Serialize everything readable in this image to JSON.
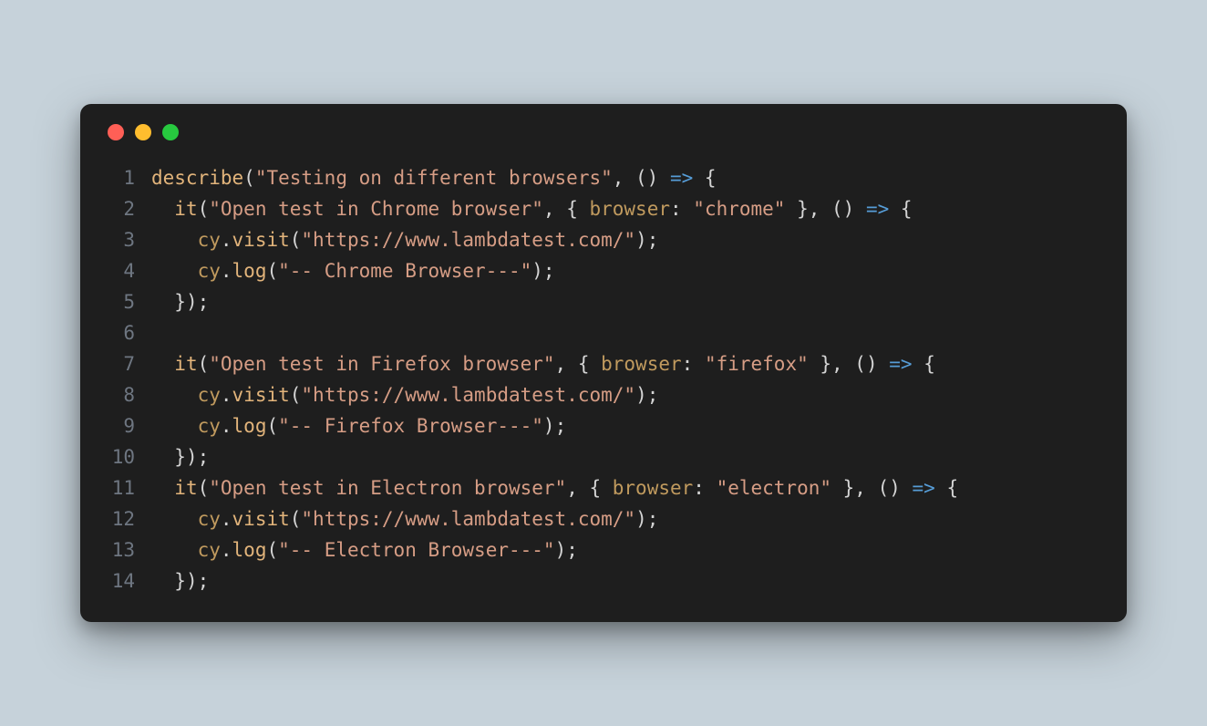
{
  "colors": {
    "background": "#c6d2da",
    "editor_bg": "#1e1e1e",
    "red": "#ff5f56",
    "yellow": "#ffbd2e",
    "green": "#27c93f",
    "lineno": "#6e7681",
    "default": "#d4d4d4",
    "func": "#e2b47b",
    "string": "#d69d85",
    "arrow": "#569cd6"
  },
  "traffic_lights": [
    "close",
    "minimize",
    "zoom"
  ],
  "code": {
    "lines": [
      {
        "n": "1",
        "indent": "",
        "tokens": [
          {
            "t": "func",
            "v": "describe"
          },
          {
            "t": "default",
            "v": "("
          },
          {
            "t": "str",
            "v": "\"Testing on different browsers\""
          },
          {
            "t": "default",
            "v": ", () "
          },
          {
            "t": "arrow",
            "v": "=>"
          },
          {
            "t": "default",
            "v": " {"
          }
        ]
      },
      {
        "n": "2",
        "indent": "  ",
        "tokens": [
          {
            "t": "func",
            "v": "it"
          },
          {
            "t": "default",
            "v": "("
          },
          {
            "t": "str",
            "v": "\"Open test in Chrome browser\""
          },
          {
            "t": "default",
            "v": ", { "
          },
          {
            "t": "key",
            "v": "browser"
          },
          {
            "t": "default",
            "v": ": "
          },
          {
            "t": "str",
            "v": "\"chrome\""
          },
          {
            "t": "default",
            "v": " }, () "
          },
          {
            "t": "arrow",
            "v": "=>"
          },
          {
            "t": "default",
            "v": " {"
          }
        ]
      },
      {
        "n": "3",
        "indent": "    ",
        "tokens": [
          {
            "t": "obj",
            "v": "cy"
          },
          {
            "t": "default",
            "v": "."
          },
          {
            "t": "func",
            "v": "visit"
          },
          {
            "t": "default",
            "v": "("
          },
          {
            "t": "str",
            "v": "\"https://www.lambdatest.com/\""
          },
          {
            "t": "default",
            "v": ");"
          }
        ]
      },
      {
        "n": "4",
        "indent": "    ",
        "tokens": [
          {
            "t": "obj",
            "v": "cy"
          },
          {
            "t": "default",
            "v": "."
          },
          {
            "t": "func",
            "v": "log"
          },
          {
            "t": "default",
            "v": "("
          },
          {
            "t": "str",
            "v": "\"-- Chrome Browser---\""
          },
          {
            "t": "default",
            "v": ");"
          }
        ]
      },
      {
        "n": "5",
        "indent": "  ",
        "tokens": [
          {
            "t": "default",
            "v": "});"
          }
        ]
      },
      {
        "n": "6",
        "indent": "",
        "tokens": []
      },
      {
        "n": "7",
        "indent": "  ",
        "tokens": [
          {
            "t": "func",
            "v": "it"
          },
          {
            "t": "default",
            "v": "("
          },
          {
            "t": "str",
            "v": "\"Open test in Firefox browser\""
          },
          {
            "t": "default",
            "v": ", { "
          },
          {
            "t": "key",
            "v": "browser"
          },
          {
            "t": "default",
            "v": ": "
          },
          {
            "t": "str",
            "v": "\"firefox\""
          },
          {
            "t": "default",
            "v": " }, () "
          },
          {
            "t": "arrow",
            "v": "=>"
          },
          {
            "t": "default",
            "v": " {"
          }
        ]
      },
      {
        "n": "8",
        "indent": "    ",
        "tokens": [
          {
            "t": "obj",
            "v": "cy"
          },
          {
            "t": "default",
            "v": "."
          },
          {
            "t": "func",
            "v": "visit"
          },
          {
            "t": "default",
            "v": "("
          },
          {
            "t": "str",
            "v": "\"https://www.lambdatest.com/\""
          },
          {
            "t": "default",
            "v": ");"
          }
        ]
      },
      {
        "n": "9",
        "indent": "    ",
        "tokens": [
          {
            "t": "obj",
            "v": "cy"
          },
          {
            "t": "default",
            "v": "."
          },
          {
            "t": "func",
            "v": "log"
          },
          {
            "t": "default",
            "v": "("
          },
          {
            "t": "str",
            "v": "\"-- Firefox Browser---\""
          },
          {
            "t": "default",
            "v": ");"
          }
        ]
      },
      {
        "n": "10",
        "indent": "  ",
        "tokens": [
          {
            "t": "default",
            "v": "});"
          }
        ]
      },
      {
        "n": "11",
        "indent": "  ",
        "tokens": [
          {
            "t": "func",
            "v": "it"
          },
          {
            "t": "default",
            "v": "("
          },
          {
            "t": "str",
            "v": "\"Open test in Electron browser\""
          },
          {
            "t": "default",
            "v": ", { "
          },
          {
            "t": "key",
            "v": "browser"
          },
          {
            "t": "default",
            "v": ": "
          },
          {
            "t": "str",
            "v": "\"electron\""
          },
          {
            "t": "default",
            "v": " }, () "
          },
          {
            "t": "arrow",
            "v": "=>"
          },
          {
            "t": "default",
            "v": " {"
          }
        ]
      },
      {
        "n": "12",
        "indent": "    ",
        "tokens": [
          {
            "t": "obj",
            "v": "cy"
          },
          {
            "t": "default",
            "v": "."
          },
          {
            "t": "func",
            "v": "visit"
          },
          {
            "t": "default",
            "v": "("
          },
          {
            "t": "str",
            "v": "\"https://www.lambdatest.com/\""
          },
          {
            "t": "default",
            "v": ");"
          }
        ]
      },
      {
        "n": "13",
        "indent": "    ",
        "tokens": [
          {
            "t": "obj",
            "v": "cy"
          },
          {
            "t": "default",
            "v": "."
          },
          {
            "t": "func",
            "v": "log"
          },
          {
            "t": "default",
            "v": "("
          },
          {
            "t": "str",
            "v": "\"-- Electron Browser---\""
          },
          {
            "t": "default",
            "v": ");"
          }
        ]
      },
      {
        "n": "14",
        "indent": "  ",
        "tokens": [
          {
            "t": "default",
            "v": "});"
          }
        ]
      }
    ]
  }
}
